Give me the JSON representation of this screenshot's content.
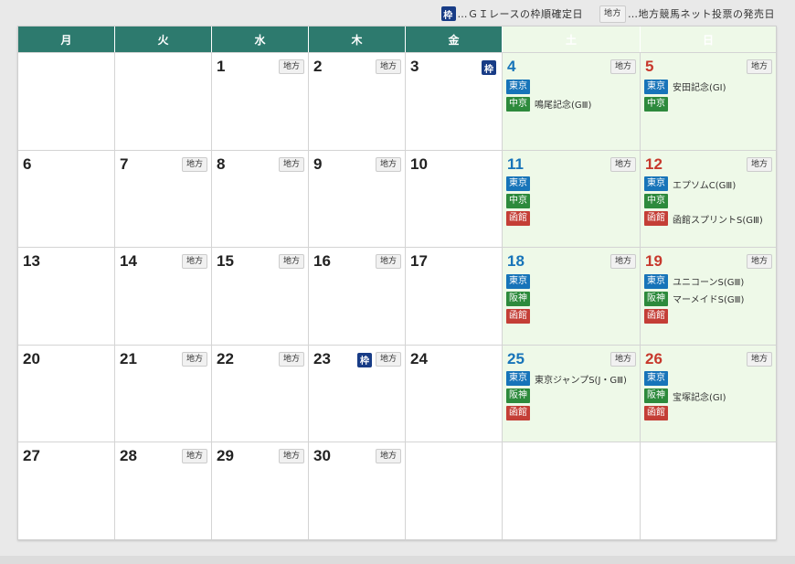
{
  "legend": {
    "waku_label": "枠",
    "waku_text": "…ＧＩレースの枠順確定日",
    "chiho_label": "地方",
    "chiho_text": "…地方競馬ネット投票の発売日"
  },
  "headers": [
    "月",
    "火",
    "水",
    "木",
    "金",
    "土",
    "日"
  ],
  "colors": {
    "weekday_header": "#2d7a6e",
    "sat_header": "#1774b9",
    "sun_header": "#d1382c",
    "weekend_bg": "#eef9e8",
    "waku": "#183c86"
  },
  "badges": {
    "chiho": "地方",
    "waku": "枠"
  },
  "weeks": [
    [
      {
        "day": "",
        "empty_white": true
      },
      {
        "day": "",
        "empty_white": true
      },
      {
        "day": "1",
        "chiho": true
      },
      {
        "day": "2",
        "chiho": true
      },
      {
        "day": "3",
        "waku": true
      },
      {
        "day": "4",
        "chiho": true,
        "venues": [
          {
            "name": "東京",
            "color": "blue"
          },
          {
            "name": "中京",
            "color": "green",
            "race": "鳴尾記念(GⅢ)"
          }
        ]
      },
      {
        "day": "5",
        "chiho": true,
        "venues": [
          {
            "name": "東京",
            "color": "blue",
            "race": "安田記念(GⅠ)"
          },
          {
            "name": "中京",
            "color": "green"
          }
        ]
      }
    ],
    [
      {
        "day": "6"
      },
      {
        "day": "7",
        "chiho": true
      },
      {
        "day": "8",
        "chiho": true
      },
      {
        "day": "9",
        "chiho": true
      },
      {
        "day": "10"
      },
      {
        "day": "11",
        "chiho": true,
        "venues": [
          {
            "name": "東京",
            "color": "blue"
          },
          {
            "name": "中京",
            "color": "green"
          },
          {
            "name": "函館",
            "color": "red"
          }
        ]
      },
      {
        "day": "12",
        "chiho": true,
        "venues": [
          {
            "name": "東京",
            "color": "blue",
            "race": "エプソムC(GⅢ)"
          },
          {
            "name": "中京",
            "color": "green"
          },
          {
            "name": "函館",
            "color": "red",
            "race": "函館スプリントS(GⅢ)"
          }
        ]
      }
    ],
    [
      {
        "day": "13"
      },
      {
        "day": "14",
        "chiho": true
      },
      {
        "day": "15",
        "chiho": true
      },
      {
        "day": "16",
        "chiho": true
      },
      {
        "day": "17"
      },
      {
        "day": "18",
        "chiho": true,
        "venues": [
          {
            "name": "東京",
            "color": "blue"
          },
          {
            "name": "阪神",
            "color": "green"
          },
          {
            "name": "函館",
            "color": "red"
          }
        ]
      },
      {
        "day": "19",
        "chiho": true,
        "venues": [
          {
            "name": "東京",
            "color": "blue",
            "race": "ユニコーンS(GⅢ)"
          },
          {
            "name": "阪神",
            "color": "green",
            "race": "マーメイドS(GⅢ)"
          },
          {
            "name": "函館",
            "color": "red"
          }
        ]
      }
    ],
    [
      {
        "day": "20"
      },
      {
        "day": "21",
        "chiho": true
      },
      {
        "day": "22",
        "chiho": true
      },
      {
        "day": "23",
        "chiho": true,
        "waku": true
      },
      {
        "day": "24"
      },
      {
        "day": "25",
        "chiho": true,
        "venues": [
          {
            "name": "東京",
            "color": "blue",
            "race": "東京ジャンプS(J・GⅢ)"
          },
          {
            "name": "阪神",
            "color": "green"
          },
          {
            "name": "函館",
            "color": "red"
          }
        ]
      },
      {
        "day": "26",
        "chiho": true,
        "venues": [
          {
            "name": "東京",
            "color": "blue"
          },
          {
            "name": "阪神",
            "color": "green",
            "race": "宝塚記念(GⅠ)"
          },
          {
            "name": "函館",
            "color": "red"
          }
        ]
      }
    ],
    [
      {
        "day": "27"
      },
      {
        "day": "28",
        "chiho": true
      },
      {
        "day": "29",
        "chiho": true
      },
      {
        "day": "30",
        "chiho": true
      },
      {
        "day": "",
        "empty_white": true
      },
      {
        "day": "",
        "empty_white": true
      },
      {
        "day": "",
        "empty_white": true
      }
    ]
  ]
}
